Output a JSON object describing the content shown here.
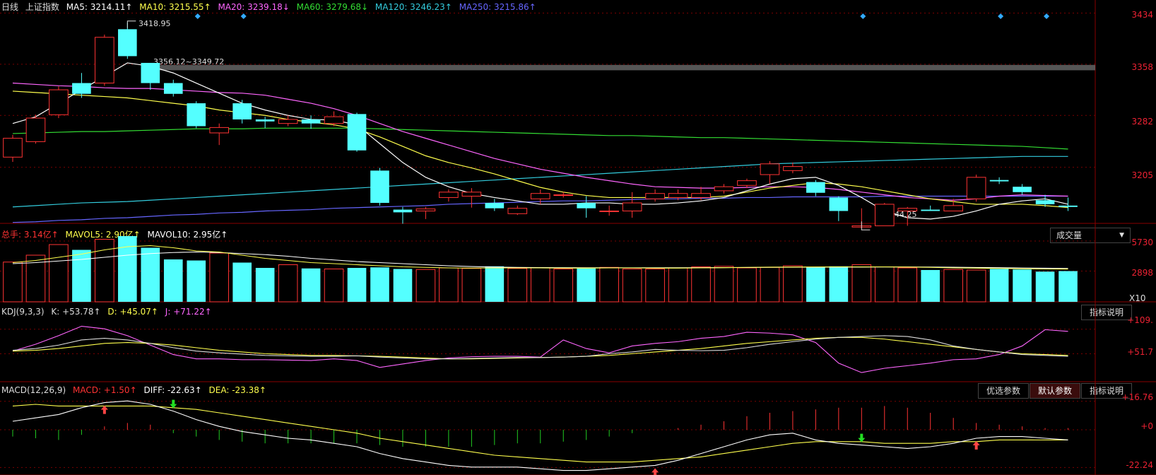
{
  "colors": {
    "up": "#ff3333",
    "down": "#54ffff",
    "ma5": "#ffffff",
    "ma10": "#ffff4d",
    "ma20": "#ff66ff",
    "ma60": "#33dd33",
    "ma120": "#33ccdd",
    "ma250": "#6666ff",
    "grid": "#7a0000",
    "axis_text": "#ff3333"
  },
  "main": {
    "title": "日线",
    "name": "上证指数",
    "ma": [
      {
        "label": "MA5: 3214.11↑",
        "color": "#ffffff"
      },
      {
        "label": "MA10: 3215.55↑",
        "color": "#ffff4d"
      },
      {
        "label": "MA20: 3239.18↓",
        "color": "#ff66ff"
      },
      {
        "label": "MA60: 3279.68↓",
        "color": "#33dd33"
      },
      {
        "label": "MA120: 3246.23↑",
        "color": "#33ccdd"
      },
      {
        "label": "MA250: 3215.86↑",
        "color": "#6666ff"
      }
    ],
    "y_ticks": [
      "3434",
      "3358",
      "3282",
      "3205"
    ],
    "annot_high": "3418.95",
    "annot_range": "3356.12~3349.72",
    "annot_low": "3144.25"
  },
  "volume": {
    "labels": [
      {
        "label": "总手: 3.14亿↑",
        "color": "#ff3333"
      },
      {
        "label": "MAVOL5: 2.90亿↑",
        "color": "#ffff4d"
      },
      {
        "label": "MAVOL10: 2.95亿↑",
        "color": "#ffffff"
      }
    ],
    "select_label": "成交量",
    "y_ticks": [
      "5730",
      "2898"
    ],
    "unit": "X10"
  },
  "kdj": {
    "labels": [
      {
        "label": "KDJ(9,3,3)",
        "color": "#dddddd"
      },
      {
        "label": "K: +53.78↑",
        "color": "#dddddd"
      },
      {
        "label": "D: +45.07↑",
        "color": "#ffff4d"
      },
      {
        "label": "J: +71.22↑",
        "color": "#ff66ff"
      }
    ],
    "help_button": "指标说明",
    "y_ticks": [
      "+109.",
      "+51.7"
    ]
  },
  "macd": {
    "labels": [
      {
        "label": "MACD(12,26,9)",
        "color": "#dddddd"
      },
      {
        "label": "MACD: +1.50↑",
        "color": "#ff3333"
      },
      {
        "label": "DIFF: -22.63↑",
        "color": "#ffffff"
      },
      {
        "label": "DEA: -23.38↑",
        "color": "#ffff4d"
      }
    ],
    "buttons": [
      "优选参数",
      "默认参数",
      "指标说明"
    ],
    "y_ticks": [
      "+16.76",
      "+0",
      "-22.24"
    ]
  },
  "chart_data": {
    "type": "candlestick",
    "y_range": [
      3130,
      3445
    ],
    "candles": [
      [
        3220,
        3248,
        3213,
        3253
      ],
      [
        3243,
        3278,
        3240,
        3283
      ],
      [
        3283,
        3320,
        3278,
        3325
      ],
      [
        3330,
        3314,
        3308,
        3345
      ],
      [
        3330,
        3398,
        3326,
        3402
      ],
      [
        3410,
        3370,
        3366,
        3420
      ],
      [
        3360,
        3330,
        3320,
        3358
      ],
      [
        3330,
        3314,
        3310,
        3335
      ],
      [
        3300,
        3266,
        3263,
        3303
      ],
      [
        3256,
        3264,
        3238,
        3270
      ],
      [
        3300,
        3276,
        3270,
        3305
      ],
      [
        3276,
        3273,
        3263,
        3280
      ],
      [
        3270,
        3276,
        3266,
        3282
      ],
      [
        3276,
        3270,
        3262,
        3282
      ],
      [
        3270,
        3280,
        3266,
        3288
      ],
      [
        3284,
        3230,
        3228,
        3286
      ],
      [
        3200,
        3152,
        3148,
        3204
      ],
      [
        3142,
        3138,
        3121,
        3146
      ],
      [
        3140,
        3143,
        3128,
        3146
      ],
      [
        3160,
        3168,
        3154,
        3172
      ],
      [
        3162,
        3168,
        3145,
        3174
      ],
      [
        3152,
        3144,
        3140,
        3158
      ],
      [
        3136,
        3144,
        3134,
        3148
      ],
      [
        3158,
        3166,
        3150,
        3172
      ],
      [
        3164,
        3164,
        3160,
        3168
      ],
      [
        3152,
        3144,
        3130,
        3162
      ],
      [
        3140,
        3140,
        3133,
        3148
      ],
      [
        3140,
        3152,
        3130,
        3168
      ],
      [
        3158,
        3166,
        3154,
        3172
      ],
      [
        3160,
        3166,
        3156,
        3172
      ],
      [
        3160,
        3166,
        3156,
        3176
      ],
      [
        3170,
        3176,
        3166,
        3180
      ],
      [
        3178,
        3185,
        3174,
        3188
      ],
      [
        3194,
        3210,
        3180,
        3214
      ],
      [
        3200,
        3206,
        3196,
        3212
      ],
      [
        3183,
        3167,
        3162,
        3186
      ],
      [
        3160,
        3140,
        3125,
        3162
      ],
      [
        3116,
        3118,
        3114,
        3144
      ],
      [
        3118,
        3150,
        3118,
        3152
      ],
      [
        3140,
        3144,
        3118,
        3146
      ],
      [
        3142,
        3140,
        3140,
        3148
      ],
      [
        3140,
        3148,
        3140,
        3158
      ],
      [
        3158,
        3190,
        3154,
        3194
      ],
      [
        3186,
        3184,
        3180,
        3190
      ],
      [
        3176,
        3168,
        3164,
        3180
      ],
      [
        3156,
        3150,
        3146,
        3164
      ],
      [
        3148,
        3146,
        3140,
        3160
      ]
    ],
    "ma5": [
      3270,
      3280,
      3300,
      3320,
      3340,
      3360,
      3355,
      3345,
      3330,
      3315,
      3300,
      3290,
      3282,
      3276,
      3275,
      3268,
      3240,
      3212,
      3190,
      3176,
      3166,
      3160,
      3155,
      3150,
      3150,
      3152,
      3152,
      3150,
      3150,
      3152,
      3155,
      3160,
      3170,
      3180,
      3188,
      3190,
      3178,
      3160,
      3140,
      3130,
      3128,
      3132,
      3140,
      3150,
      3155,
      3158,
      3150
    ],
    "ma10": [
      3318,
      3316,
      3314,
      3312,
      3310,
      3308,
      3304,
      3300,
      3296,
      3290,
      3286,
      3282,
      3276,
      3272,
      3268,
      3262,
      3250,
      3236,
      3222,
      3212,
      3204,
      3195,
      3185,
      3175,
      3168,
      3163,
      3160,
      3160,
      3160,
      3160,
      3160,
      3162,
      3168,
      3174,
      3178,
      3182,
      3180,
      3176,
      3170,
      3164,
      3158,
      3154,
      3150,
      3150,
      3150,
      3148,
      3145
    ],
    "ma20": [
      3330,
      3328,
      3326,
      3325,
      3323,
      3322,
      3322,
      3320,
      3318,
      3316,
      3315,
      3312,
      3306,
      3300,
      3292,
      3282,
      3270,
      3258,
      3248,
      3238,
      3228,
      3218,
      3210,
      3202,
      3196,
      3190,
      3185,
      3180,
      3176,
      3175,
      3174,
      3174,
      3175,
      3176,
      3176,
      3175,
      3172,
      3168,
      3164,
      3160,
      3158,
      3156,
      3158,
      3162,
      3164,
      3163,
      3162
    ],
    "ma60": [
      3255,
      3256,
      3257,
      3258,
      3258,
      3259,
      3260,
      3261,
      3262,
      3262,
      3262,
      3263,
      3263,
      3263,
      3263,
      3263,
      3262,
      3261,
      3260,
      3259,
      3258,
      3257,
      3256,
      3255,
      3254,
      3253,
      3252,
      3252,
      3251,
      3250,
      3249,
      3249,
      3248,
      3247,
      3246,
      3245,
      3244,
      3243,
      3242,
      3241,
      3240,
      3239,
      3238,
      3237,
      3236,
      3234,
      3232
    ],
    "ma120": [
      3146,
      3148,
      3150,
      3152,
      3153,
      3154,
      3156,
      3158,
      3160,
      3162,
      3164,
      3166,
      3168,
      3170,
      3172,
      3174,
      3176,
      3178,
      3180,
      3182,
      3184,
      3186,
      3188,
      3190,
      3192,
      3194,
      3196,
      3198,
      3200,
      3202,
      3204,
      3206,
      3208,
      3210,
      3211,
      3212,
      3213,
      3214,
      3215,
      3216,
      3217,
      3218,
      3219,
      3220,
      3221,
      3221,
      3221
    ],
    "ma250": [
      3123,
      3124,
      3126,
      3127,
      3129,
      3130,
      3132,
      3134,
      3135,
      3137,
      3138,
      3140,
      3141,
      3142,
      3144,
      3145,
      3146,
      3147,
      3148,
      3150,
      3151,
      3152,
      3153,
      3154,
      3155,
      3155,
      3156,
      3157,
      3158,
      3158,
      3159,
      3159,
      3160,
      3160,
      3161,
      3161,
      3161,
      3161,
      3162,
      3162,
      3162,
      3162,
      3162,
      3162,
      3162,
      3162,
      3162
    ],
    "volume_range": [
      0,
      6200
    ],
    "volume": [
      3750,
      4400,
      5400,
      4900,
      5900,
      6200,
      5100,
      4000,
      3900,
      4600,
      3700,
      3200,
      3500,
      3150,
      3100,
      3200,
      3250,
      3100,
      3050,
      3200,
      3150,
      3350,
      3150,
      3200,
      3100,
      3150,
      3250,
      3100,
      3100,
      3200,
      3300,
      3350,
      3200,
      3250,
      3400,
      3300,
      3350,
      3500,
      3300,
      3200,
      3000,
      3050,
      3000,
      3100,
      3050,
      2850,
      2900
    ],
    "mavol5": [
      3700,
      3900,
      4200,
      4500,
      4900,
      5200,
      5300,
      5100,
      4800,
      4700,
      4400,
      4100,
      3900,
      3700,
      3600,
      3500,
      3400,
      3300,
      3250,
      3200,
      3180,
      3200,
      3200,
      3200,
      3180,
      3180,
      3200,
      3200,
      3180,
      3180,
      3200,
      3220,
      3250,
      3270,
      3280,
      3290,
      3300,
      3300,
      3300,
      3280,
      3250,
      3200,
      3180,
      3150,
      3120,
      3100,
      3090
    ],
    "mavol10": [
      3600,
      3700,
      3850,
      4000,
      4200,
      4400,
      4550,
      4650,
      4700,
      4650,
      4550,
      4450,
      4300,
      4100,
      3950,
      3800,
      3700,
      3600,
      3500,
      3400,
      3330,
      3280,
      3250,
      3230,
      3220,
      3210,
      3210,
      3210,
      3210,
      3210,
      3220,
      3230,
      3240,
      3250,
      3260,
      3270,
      3280,
      3280,
      3290,
      3290,
      3280,
      3260,
      3240,
      3220,
      3190,
      3170,
      3150
    ],
    "kdj_range": [
      -10,
      135
    ],
    "k": [
      60,
      64,
      72,
      84,
      88,
      84,
      76,
      66,
      58,
      54,
      51,
      48,
      47,
      46,
      46,
      47,
      44,
      42,
      40,
      40,
      41,
      42,
      43,
      43,
      44,
      46,
      52,
      56,
      62,
      60,
      59,
      60,
      66,
      74,
      80,
      86,
      90,
      92,
      94,
      92,
      84,
      70,
      62,
      56,
      50,
      48,
      46,
      46
    ],
    "d": [
      58,
      60,
      64,
      70,
      76,
      78,
      76,
      72,
      66,
      60,
      56,
      52,
      50,
      48,
      48,
      47,
      46,
      44,
      42,
      40,
      40,
      41,
      42,
      43,
      44,
      46,
      48,
      52,
      56,
      60,
      64,
      70,
      76,
      80,
      84,
      88,
      90,
      90,
      86,
      80,
      74,
      68,
      62,
      56,
      52,
      50,
      48,
      46
    ],
    "j": [
      58,
      74,
      94,
      116,
      110,
      94,
      72,
      50,
      40,
      40,
      38,
      38,
      37,
      36,
      40,
      36,
      20,
      28,
      36,
      42,
      45,
      46,
      46,
      44,
      84,
      64,
      54,
      70,
      76,
      80,
      88,
      92,
      102,
      100,
      96,
      78,
      30,
      8,
      18,
      24,
      30,
      38,
      40,
      50,
      70,
      108,
      104,
      88
    ],
    "macd_range": [
      -25,
      20
    ],
    "diff": [
      5,
      7,
      9,
      13,
      16,
      17,
      15,
      11,
      6,
      2,
      -1,
      -3,
      -5,
      -6,
      -8,
      -10,
      -14,
      -17,
      -19,
      -21,
      -22,
      -22,
      -22,
      -23,
      -24,
      -24,
      -23,
      -22,
      -21,
      -18,
      -14,
      -10,
      -6,
      -3,
      -2,
      -6,
      -8,
      -9,
      -10,
      -11,
      -10,
      -8,
      -5,
      -4,
      -4,
      -5,
      -6
    ],
    "dea": [
      14,
      15,
      14,
      14,
      14,
      14,
      14,
      13,
      12,
      10,
      8,
      6,
      4,
      2,
      0,
      -2,
      -5,
      -7,
      -9,
      -11,
      -13,
      -15,
      -16,
      -17,
      -18,
      -19,
      -19,
      -19,
      -18,
      -17,
      -16,
      -14,
      -12,
      -10,
      -8,
      -7,
      -7,
      -7,
      -8,
      -8,
      -8,
      -7,
      -7,
      -6,
      -6,
      -6,
      -6
    ],
    "macd_hist": [
      -4,
      -5,
      -6,
      -3,
      2,
      4,
      3,
      -2,
      -4,
      -6,
      -7,
      -8,
      -8,
      -8,
      -8,
      -8,
      -9,
      -10,
      -10,
      -10,
      -10,
      -9,
      -8,
      -8,
      -7,
      -6,
      -4,
      -2,
      0,
      1,
      3,
      5,
      8,
      10,
      11,
      12,
      13,
      13,
      14,
      13,
      10,
      7,
      4,
      3,
      2,
      1,
      1
    ]
  }
}
